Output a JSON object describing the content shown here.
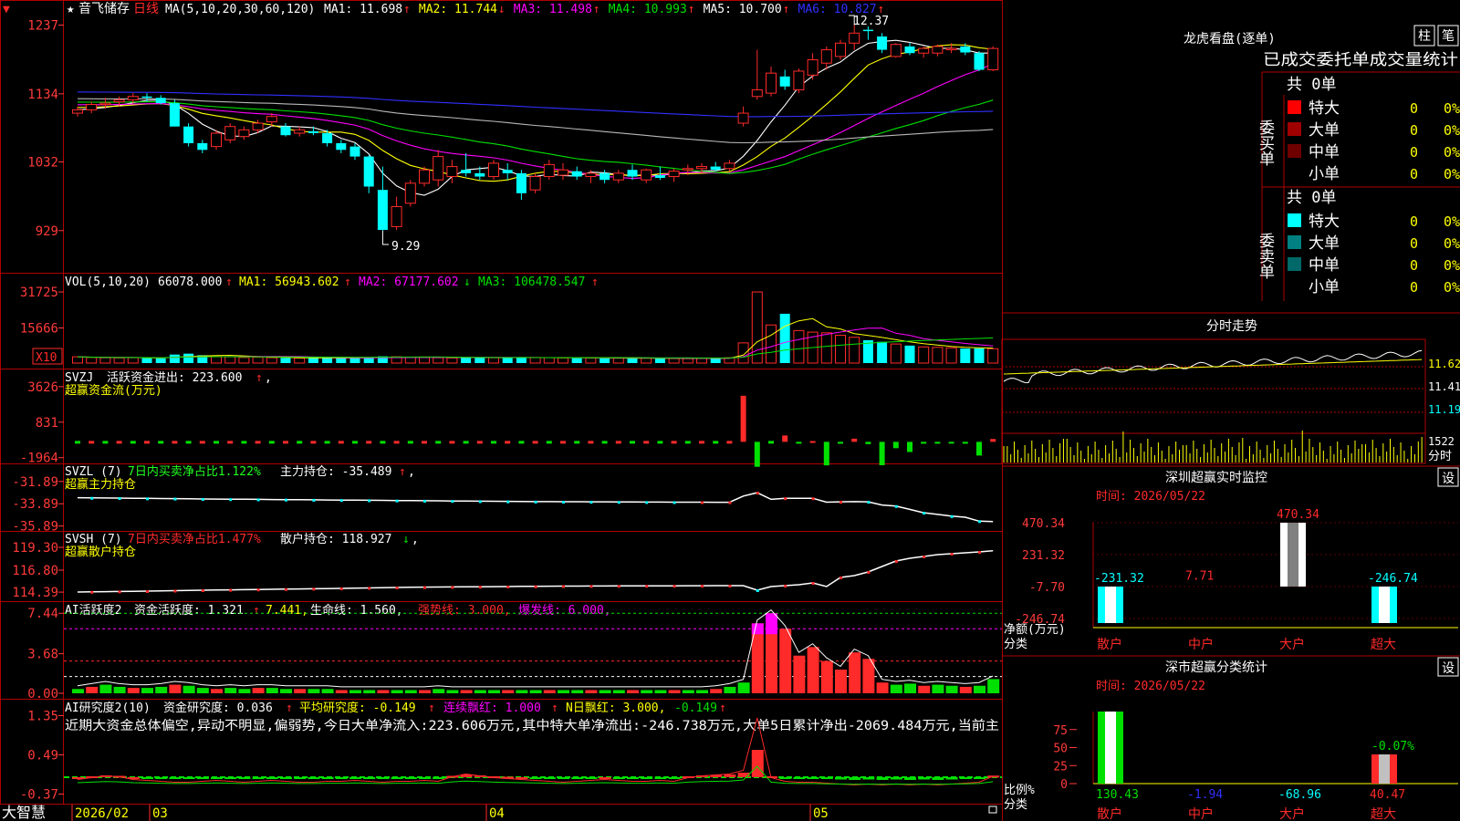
{
  "colors": {
    "bg": "#000000",
    "border": "#b00000",
    "up": "#ff2a2a",
    "down": "#00ffff",
    "white": "#ffffff",
    "yellow": "#ffff00",
    "magenta": "#ff00ff",
    "green": "#00e000",
    "blue": "#3030ff",
    "gray": "#b8b8b8",
    "axis": "#ff3a3a",
    "hdr": "#ff4040",
    "brightgreen": "#22ff22"
  },
  "main": {
    "mark": "▼",
    "star": "★",
    "stock": "音飞储存",
    "period": "日线",
    "ma_prefix": "MA(5,10,20,30,60,120)",
    "ma": [
      {
        "label": "MA1:",
        "value": "11.698",
        "arrow": "↑",
        "color": "#ffffff"
      },
      {
        "label": "MA2:",
        "value": "11.744",
        "arrow": "↓",
        "color": "#ffff00"
      },
      {
        "label": "MA3:",
        "value": "11.498",
        "arrow": "↑",
        "color": "#ff00ff"
      },
      {
        "label": "MA4:",
        "value": "10.993",
        "arrow": "↑",
        "color": "#00e000"
      },
      {
        "label": "MA5:",
        "value": "10.700",
        "arrow": "↑",
        "color": "#ffffff"
      },
      {
        "label": "MA6:",
        "value": "10.827",
        "arrow": "↑",
        "color": "#3030ff"
      }
    ],
    "y_ticks": [
      "1237",
      "1134",
      "1032",
      "929"
    ],
    "high_label": "12.37",
    "low_label": "9.29"
  },
  "vol": {
    "head": "VOL(5,10,20)",
    "value": "66078.000",
    "arrow": "↑",
    "ma1": "MA1: 56943.602",
    "ma1_arrow": "↑",
    "ma2": "MA2: 67177.602",
    "ma2_arrow": "↓",
    "ma3": "MA3: 106478.547",
    "ma3_arrow": "↑",
    "y_ticks": [
      "31725",
      "15666"
    ],
    "unit": "X10"
  },
  "svzj": {
    "head": "SVZJ",
    "title": "活跃资金进出: 223.600",
    "arrow": "↑",
    "sep": ",",
    "sub": "超赢资金流(万元)",
    "y_ticks": [
      "3626",
      "831",
      "-1964"
    ]
  },
  "svzl": {
    "head": "SVZL (7)",
    "title": "7日内买卖净占比1.122%",
    "tail": "主力持仓: -35.489",
    "arrow": "↑",
    "sep": ",",
    "sub": "超赢主力持仓",
    "y_ticks": [
      "-31.89",
      "-33.89",
      "-35.89"
    ]
  },
  "svsh": {
    "head": "SVSH (7)",
    "title": "7日内买卖净占比1.477%",
    "tail": "散户持仓: 118.927",
    "arrow": "↓",
    "sep": ",",
    "sub": "超赢散户持仓",
    "y_ticks": [
      "119.30",
      "116.80",
      "114.39"
    ]
  },
  "ai1": {
    "head": "AI活跃度2",
    "t1": "资金活跃度: 1.321",
    "a1": "↑",
    "t2": "7.441,",
    "t3": "生命线: 1.560,",
    "t4": "强势线: 3.000,",
    "t5": "爆发线: 6.000,",
    "y_ticks": [
      "7.44",
      "3.68",
      "0.00"
    ]
  },
  "ai2": {
    "head": "AI研究度2(10)",
    "t1": "资金研究度: 0.036",
    "a1": "↑",
    "t2": "平均研究度: -0.149",
    "a2": "↑",
    "t3": "连续飘红: 1.000",
    "a3": "↑",
    "t4": "N日飘红: 3.000,",
    "t5": "-0.149",
    "a5": "↑",
    "desc": "近期大资金总体偏空,异动不明显,偏弱势,今日大单净流入:223.606万元,其中特大单净流出:-246.738万元,大单5日累计净出-2069.484万元,当前主",
    "y_ticks": [
      "1.35",
      "0.49",
      "-0.37"
    ]
  },
  "bottom": {
    "brand": "大智慧",
    "dates": [
      "2026/02",
      "03",
      "04",
      "05"
    ]
  },
  "right": {
    "lhb_title": "龙虎看盘(逐单)",
    "btn1": "柱",
    "btn2": "笔",
    "tabs_line": "已成交委托单成交量统计",
    "buy_total": "共 0单",
    "buy_side": "委买单",
    "sell_total": "共 0单",
    "sell_side": "委卖单",
    "buy_rows": [
      {
        "name": "特大",
        "count": "0",
        "pct": "0%",
        "color": "#ff0000"
      },
      {
        "name": "大单",
        "count": "0",
        "pct": "0%",
        "color": "#a00000"
      },
      {
        "name": "中单",
        "count": "0",
        "pct": "0%",
        "color": "#700000"
      },
      {
        "name": "小单",
        "count": "0",
        "pct": "0%",
        "color": "#000000"
      }
    ],
    "sell_rows": [
      {
        "name": "特大",
        "count": "0",
        "pct": "0%",
        "color": "#00ffff"
      },
      {
        "name": "大单",
        "count": "0",
        "pct": "0%",
        "color": "#008080"
      },
      {
        "name": "中单",
        "count": "0",
        "pct": "0%",
        "color": "#006868"
      },
      {
        "name": "小单",
        "count": "0",
        "pct": "0%",
        "color": "#000000"
      }
    ],
    "fs_title": "分时走势",
    "fs_ticks": [
      "11.62",
      "11.41",
      "11.19",
      "1522"
    ],
    "fs_unit": "分时",
    "sz1_title": "深圳超赢实时监控",
    "set_label": "设",
    "date_label": "时间: 2026/05/22",
    "net_label": "净额(万元)",
    "cat_label": "分类",
    "sz1_y": [
      "470.34",
      "231.32",
      "-7.70",
      "-246.74"
    ],
    "sz1_vals": [
      {
        "name": "散户",
        "value": "-231.32"
      },
      {
        "name": "中户",
        "value": "7.71"
      },
      {
        "name": "大户",
        "value": "470.34"
      },
      {
        "name": "超大",
        "value": "-246.74"
      }
    ],
    "sz2_title": "深市超赢分类统计",
    "ratio_label": "比例%",
    "sz2_y": [
      "75",
      "50",
      "25",
      "0"
    ],
    "sz2_vals": [
      {
        "name": "散户",
        "value": "130.43"
      },
      {
        "name": "中户",
        "value": "-1.94"
      },
      {
        "name": "大户",
        "value": "-68.96"
      },
      {
        "name": "超大",
        "value": "40.47"
      }
    ],
    "sz2_pct": "-0.07%"
  },
  "chart_data": [
    {
      "type": "candlestick",
      "title": "音飞储存 日线",
      "ylim": [
        9.0,
        12.5
      ],
      "series": [
        {
          "name": "K",
          "ohlc": [
            [
              11.05,
              11.15,
              11.0,
              11.1
            ],
            [
              11.1,
              11.22,
              11.05,
              11.18
            ],
            [
              11.18,
              11.28,
              11.12,
              11.2
            ],
            [
              11.22,
              11.3,
              11.15,
              11.25
            ],
            [
              11.25,
              11.35,
              11.2,
              11.3
            ],
            [
              11.3,
              11.35,
              11.22,
              11.28
            ],
            [
              11.28,
              11.32,
              11.18,
              11.2
            ],
            [
              11.2,
              11.25,
              10.95,
              10.85
            ],
            [
              10.85,
              10.9,
              10.55,
              10.6
            ],
            [
              10.6,
              10.65,
              10.45,
              10.5
            ],
            [
              10.55,
              10.8,
              10.5,
              10.75
            ],
            [
              10.65,
              10.9,
              10.6,
              10.85
            ],
            [
              10.7,
              10.85,
              10.65,
              10.8
            ],
            [
              10.8,
              10.95,
              10.75,
              10.9
            ],
            [
              10.92,
              11.05,
              10.85,
              11.0
            ],
            [
              10.85,
              10.9,
              10.7,
              10.72
            ],
            [
              10.75,
              10.85,
              10.7,
              10.8
            ],
            [
              10.78,
              10.85,
              10.72,
              10.75
            ],
            [
              10.75,
              10.8,
              10.55,
              10.6
            ],
            [
              10.6,
              10.65,
              10.45,
              10.5
            ],
            [
              10.55,
              10.6,
              10.35,
              10.4
            ],
            [
              10.4,
              10.42,
              9.85,
              9.95
            ],
            [
              9.9,
              10.25,
              9.29,
              9.3
            ],
            [
              9.35,
              9.8,
              9.3,
              9.65
            ],
            [
              9.7,
              10.05,
              9.65,
              10.0
            ],
            [
              10.0,
              10.25,
              9.95,
              10.2
            ],
            [
              10.05,
              10.5,
              9.95,
              10.4
            ],
            [
              10.1,
              10.35,
              10.0,
              10.25
            ],
            [
              10.2,
              10.45,
              10.1,
              10.15
            ],
            [
              10.15,
              10.25,
              10.05,
              10.1
            ],
            [
              10.1,
              10.35,
              10.05,
              10.3
            ],
            [
              10.2,
              10.3,
              10.05,
              10.15
            ],
            [
              10.15,
              10.2,
              9.75,
              9.85
            ],
            [
              9.9,
              10.15,
              9.85,
              10.1
            ],
            [
              10.1,
              10.35,
              10.05,
              10.28
            ],
            [
              10.12,
              10.3,
              10.05,
              10.2
            ],
            [
              10.18,
              10.25,
              10.05,
              10.1
            ],
            [
              10.1,
              10.2,
              10.0,
              10.15
            ],
            [
              10.15,
              10.2,
              10.0,
              10.05
            ],
            [
              10.05,
              10.2,
              10.0,
              10.15
            ],
            [
              10.2,
              10.28,
              10.05,
              10.1
            ],
            [
              10.05,
              10.22,
              10.0,
              10.2
            ],
            [
              10.12,
              10.25,
              10.05,
              10.08
            ],
            [
              10.1,
              10.22,
              10.02,
              10.18
            ],
            [
              10.2,
              10.28,
              10.12,
              10.22
            ],
            [
              10.22,
              10.3,
              10.15,
              10.25
            ],
            [
              10.25,
              10.32,
              10.18,
              10.2
            ],
            [
              10.22,
              10.35,
              10.18,
              10.3
            ],
            [
              10.9,
              11.15,
              10.85,
              11.05
            ],
            [
              11.3,
              12.0,
              11.25,
              11.4
            ],
            [
              11.35,
              11.75,
              11.3,
              11.65
            ],
            [
              11.6,
              11.7,
              11.4,
              11.45
            ],
            [
              11.4,
              11.72,
              11.35,
              11.68
            ],
            [
              11.62,
              11.95,
              11.55,
              11.85
            ],
            [
              11.8,
              12.05,
              11.7,
              12.0
            ],
            [
              11.9,
              12.15,
              11.85,
              12.1
            ],
            [
              12.1,
              12.37,
              12.0,
              12.25
            ],
            [
              12.3,
              12.35,
              12.15,
              12.28
            ],
            [
              12.2,
              12.25,
              11.95,
              12.0
            ],
            [
              11.9,
              12.1,
              11.88,
              12.08
            ],
            [
              12.05,
              12.1,
              11.92,
              11.95
            ],
            [
              11.95,
              12.05,
              11.88,
              12.02
            ],
            [
              11.95,
              12.08,
              11.9,
              12.05
            ],
            [
              12.0,
              12.1,
              11.95,
              12.02
            ],
            [
              12.05,
              12.1,
              11.92,
              11.96
            ],
            [
              11.95,
              11.98,
              11.68,
              11.7
            ],
            [
              11.7,
              12.05,
              11.68,
              12.02
            ]
          ]
        }
      ]
    },
    {
      "type": "bar",
      "title": "VOL(5,10,20)",
      "ylim": [
        0,
        35000
      ],
      "values": [
        2800,
        2500,
        2400,
        2300,
        2400,
        2200,
        2100,
        3800,
        4200,
        3500,
        3000,
        2800,
        2500,
        2600,
        2400,
        2300,
        2200,
        2300,
        2400,
        2200,
        2300,
        2600,
        3000,
        2800,
        2600,
        2500,
        2400,
        2300,
        2600,
        2500,
        2400,
        2300,
        2600,
        2500,
        2400,
        2300,
        2200,
        2300,
        2100,
        2200,
        2100,
        2200,
        2000,
        2100,
        2000,
        2200,
        2100,
        2400,
        9000,
        31725,
        17000,
        22000,
        14500,
        13800,
        13500,
        12400,
        11500,
        10200,
        9500,
        8500,
        7800,
        7200,
        7000,
        6800,
        6500,
        6600,
        6400
      ]
    },
    {
      "type": "bar",
      "title": "超赢资金流(万元)",
      "ylim": [
        -2200,
        3900
      ],
      "values": [
        0,
        0,
        0,
        0,
        0,
        0,
        0,
        0,
        0,
        0,
        0,
        0,
        0,
        0,
        0,
        0,
        0,
        0,
        0,
        0,
        0,
        0,
        0,
        0,
        0,
        0,
        0,
        0,
        0,
        0,
        0,
        0,
        0,
        0,
        0,
        0,
        0,
        0,
        0,
        0,
        0,
        0,
        0,
        0,
        0,
        0,
        0,
        0,
        3626,
        -1964,
        0,
        500,
        -150,
        60,
        -1850,
        -150,
        250,
        -180,
        -1840,
        -500,
        -800,
        -150,
        -150,
        -120,
        -150,
        -1080,
        224
      ]
    },
    {
      "type": "line",
      "title": "超赢主力持仓",
      "ylim": [
        -36.0,
        -31.5
      ],
      "values": [
        -33.35,
        -33.36,
        -33.37,
        -33.38,
        -33.4,
        -33.41,
        -33.42,
        -33.43,
        -33.45,
        -33.46,
        -33.47,
        -33.48,
        -33.49,
        -33.5,
        -33.51,
        -33.52,
        -33.53,
        -33.54,
        -33.55,
        -33.56,
        -33.57,
        -33.58,
        -33.59,
        -33.6,
        -33.61,
        -33.62,
        -33.63,
        -33.64,
        -33.65,
        -33.66,
        -33.67,
        -33.68,
        -33.69,
        -33.7,
        -33.7,
        -33.71,
        -33.71,
        -33.72,
        -33.72,
        -33.73,
        -33.73,
        -33.74,
        -33.74,
        -33.75,
        -33.75,
        -33.75,
        -33.76,
        -33.76,
        -33.2,
        -32.9,
        -33.5,
        -33.4,
        -33.4,
        -33.4,
        -33.75,
        -33.72,
        -33.7,
        -33.72,
        -34.0,
        -34.1,
        -34.4,
        -34.7,
        -34.85,
        -35.0,
        -35.1,
        -35.45,
        -35.49
      ]
    },
    {
      "type": "line",
      "title": "超赢散户持仓",
      "ylim": [
        114.2,
        119.6
      ],
      "values": [
        114.4,
        114.42,
        114.44,
        114.46,
        114.48,
        114.5,
        114.52,
        114.55,
        114.57,
        114.6,
        114.62,
        114.64,
        114.66,
        114.68,
        114.7,
        114.72,
        114.74,
        114.76,
        114.78,
        114.8,
        114.82,
        114.85,
        114.88,
        114.9,
        114.92,
        114.94,
        114.95,
        114.96,
        114.97,
        114.98,
        114.99,
        115.0,
        115.02,
        115.03,
        115.04,
        115.05,
        115.05,
        115.06,
        115.06,
        115.07,
        115.07,
        115.08,
        115.08,
        115.08,
        115.09,
        115.09,
        115.1,
        115.1,
        115.1,
        114.6,
        115.0,
        115.1,
        115.2,
        115.4,
        115.0,
        116.0,
        116.2,
        116.6,
        117.2,
        117.8,
        118.1,
        118.3,
        118.5,
        118.6,
        118.7,
        118.8,
        118.93
      ]
    },
    {
      "type": "bar",
      "title": "AI活跃度2",
      "ylim": [
        0,
        7.8
      ],
      "values": [
        0.4,
        0.6,
        0.8,
        0.6,
        0.5,
        0.5,
        0.6,
        0.8,
        0.7,
        0.5,
        0.4,
        0.5,
        0.4,
        0.5,
        0.5,
        0.4,
        0.4,
        0.4,
        0.4,
        0.3,
        0.3,
        0.3,
        0.3,
        0.3,
        0.3,
        0.3,
        0.4,
        0.3,
        0.3,
        0.3,
        0.3,
        0.3,
        0.3,
        0.3,
        0.3,
        0.3,
        0.3,
        0.3,
        0.3,
        0.3,
        0.3,
        0.3,
        0.3,
        0.3,
        0.3,
        0.3,
        0.4,
        0.6,
        1.0,
        6.5,
        7.44,
        6.0,
        3.5,
        4.3,
        3.0,
        2.2,
        3.8,
        3.2,
        1.0,
        0.8,
        0.9,
        0.7,
        0.8,
        0.7,
        0.6,
        0.7,
        1.321
      ]
    },
    {
      "type": "bar",
      "title": "AI研究度2(10)",
      "ylim": [
        -0.4,
        1.4
      ],
      "values": [
        0.0,
        0.02,
        0.04,
        0.03,
        0.0,
        -0.01,
        -0.02,
        -0.03,
        -0.03,
        -0.02,
        -0.01,
        -0.02,
        -0.03,
        -0.02,
        -0.01,
        -0.02,
        -0.03,
        -0.03,
        -0.02,
        -0.02,
        -0.01,
        -0.02,
        -0.03,
        -0.02,
        -0.02,
        -0.01,
        -0.02,
        0.03,
        0.06,
        0.04,
        0.02,
        0.01,
        0.0,
        -0.01,
        -0.02,
        -0.03,
        -0.02,
        -0.01,
        0.0,
        -0.01,
        -0.02,
        -0.02,
        -0.01,
        -0.02,
        0.02,
        0.04,
        0.05,
        0.06,
        0.1,
        0.6,
        0.02,
        -0.02,
        -0.03,
        -0.03,
        -0.04,
        -0.05,
        -0.06,
        -0.05,
        -0.06,
        -0.05,
        -0.06,
        -0.05,
        -0.06,
        -0.05,
        -0.04,
        -0.03,
        0.036
      ]
    },
    {
      "type": "bar",
      "title": "深圳超赢实时监控",
      "categories": [
        "散户",
        "中户",
        "大户",
        "超大"
      ],
      "values": [
        -231.32,
        7.71,
        470.34,
        -246.74
      ]
    },
    {
      "type": "bar",
      "title": "深市超赢分类统计",
      "categories": [
        "散户",
        "中户",
        "大户",
        "超大"
      ],
      "values": [
        130.43,
        -1.94,
        -68.96,
        40.47
      ]
    }
  ]
}
